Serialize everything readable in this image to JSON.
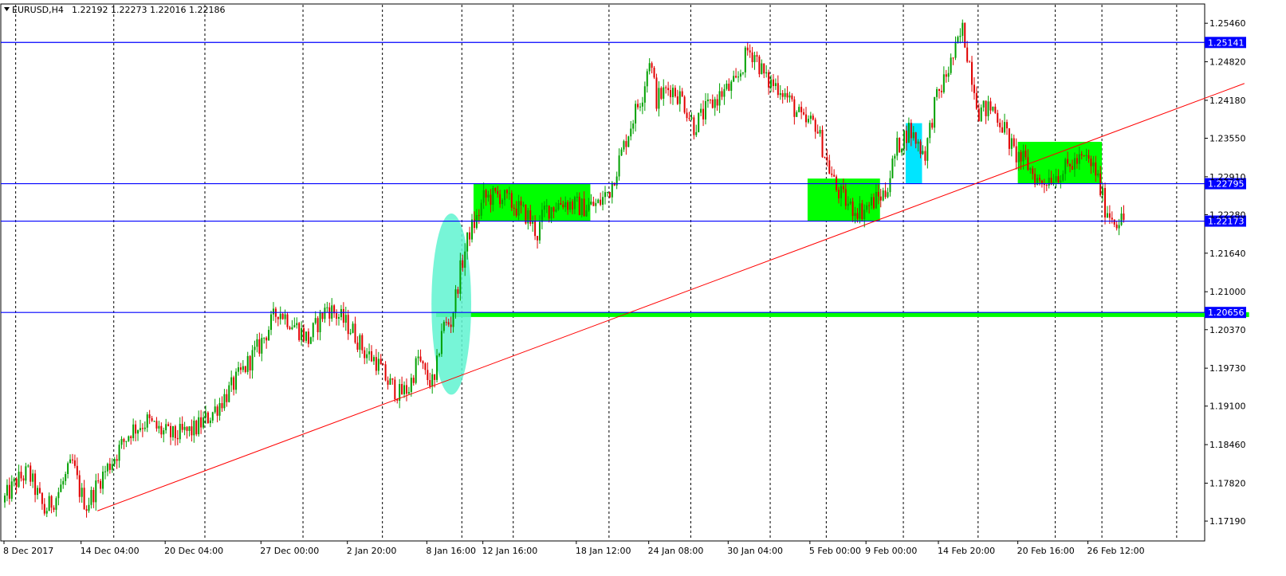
{
  "header": {
    "symbol": "EURUSD,H4",
    "quote": "1.22192 1.22273 1.22016 1.22186",
    "menu_icon": "triangle-down-icon"
  },
  "colors": {
    "bull": "#00a000",
    "bear": "#e00000",
    "level_line": "#0000ff",
    "trend_line": "#ff0000",
    "zone": "#00ff00",
    "highlight": "#5ff3d0",
    "marker": "#00e5ff"
  },
  "chart_data": {
    "type": "candlestick",
    "symbol": "EURUSD",
    "timeframe": "H4",
    "ylim": [
      1.1686,
      1.2578
    ],
    "y_ticks": [
      1.2546,
      1.2482,
      1.2418,
      1.2355,
      1.2291,
      1.2228,
      1.2164,
      1.21,
      1.2037,
      1.1973,
      1.191,
      1.1846,
      1.1782,
      1.1719
    ],
    "y_tick_labels": [
      "1.25460",
      "1.24820",
      "1.24180",
      "1.23550",
      "1.22910",
      "1.22280",
      "1.21640",
      "1.21000",
      "1.20370",
      "1.19730",
      "1.19100",
      "1.18460",
      "1.17820",
      "1.17190"
    ],
    "x_labels": [
      {
        "label": "8 Dec 2017",
        "bar": 0
      },
      {
        "label": "14 Dec 04:00",
        "bar": 33
      },
      {
        "label": "20 Dec 04:00",
        "bar": 69
      },
      {
        "label": "27 Dec 00:00",
        "bar": 110
      },
      {
        "label": "2 Jan 20:00",
        "bar": 147
      },
      {
        "label": "8 Jan 16:00",
        "bar": 181
      },
      {
        "label": "12 Jan 16:00",
        "bar": 205
      },
      {
        "label": "18 Jan 12:00",
        "bar": 245
      },
      {
        "label": "24 Jan 08:00",
        "bar": 276
      },
      {
        "label": "30 Jan 04:00",
        "bar": 310
      },
      {
        "label": "5 Feb 00:00",
        "bar": 345
      },
      {
        "label": "9 Feb 00:00",
        "bar": 369
      },
      {
        "label": "14 Feb 20:00",
        "bar": 400
      },
      {
        "label": "20 Feb 16:00",
        "bar": 434
      },
      {
        "label": "26 Feb 12:00",
        "bar": 464
      }
    ],
    "period_separators_bar": [
      5,
      47,
      86,
      128,
      162,
      196,
      218,
      259,
      294,
      328,
      352,
      385,
      417,
      450,
      470,
      502
    ],
    "anchors": [
      [
        0,
        1.175
      ],
      [
        6,
        1.1785
      ],
      [
        11,
        1.18
      ],
      [
        18,
        1.1735
      ],
      [
        23,
        1.176
      ],
      [
        30,
        1.1815
      ],
      [
        33,
        1.177
      ],
      [
        36,
        1.1745
      ],
      [
        42,
        1.179
      ],
      [
        47,
        1.182
      ],
      [
        55,
        1.187
      ],
      [
        62,
        1.1885
      ],
      [
        67,
        1.187
      ],
      [
        73,
        1.186
      ],
      [
        82,
        1.187
      ],
      [
        89,
        1.1895
      ],
      [
        97,
        1.1935
      ],
      [
        104,
        1.1975
      ],
      [
        110,
        1.201
      ],
      [
        114,
        1.204
      ],
      [
        118,
        1.207
      ],
      [
        125,
        1.2045
      ],
      [
        131,
        1.202
      ],
      [
        136,
        1.2055
      ],
      [
        139,
        1.2075
      ],
      [
        145,
        1.2055
      ],
      [
        150,
        1.2035
      ],
      [
        155,
        1.2
      ],
      [
        160,
        1.1985
      ],
      [
        165,
        1.195
      ],
      [
        170,
        1.193
      ],
      [
        174,
        1.194
      ],
      [
        178,
        1.199
      ],
      [
        181,
        1.196
      ],
      [
        185,
        1.1945
      ],
      [
        188,
        1.204
      ],
      [
        192,
        1.205
      ],
      [
        196,
        1.2135
      ],
      [
        200,
        1.22
      ],
      [
        203,
        1.222
      ],
      [
        206,
        1.2255
      ],
      [
        213,
        1.226
      ],
      [
        220,
        1.224
      ],
      [
        225,
        1.2225
      ],
      [
        229,
        1.2195
      ],
      [
        232,
        1.2235
      ],
      [
        240,
        1.225
      ],
      [
        248,
        1.224
      ],
      [
        255,
        1.2245
      ],
      [
        260,
        1.227
      ],
      [
        265,
        1.233
      ],
      [
        270,
        1.239
      ],
      [
        274,
        1.243
      ],
      [
        277,
        1.249
      ],
      [
        280,
        1.242
      ],
      [
        286,
        1.244
      ],
      [
        291,
        1.242
      ],
      [
        296,
        1.2375
      ],
      [
        302,
        1.2405
      ],
      [
        308,
        1.243
      ],
      [
        314,
        1.2445
      ],
      [
        319,
        1.25
      ],
      [
        322,
        1.2495
      ],
      [
        327,
        1.245
      ],
      [
        333,
        1.244
      ],
      [
        338,
        1.241
      ],
      [
        343,
        1.238
      ],
      [
        348,
        1.238
      ],
      [
        353,
        1.2315
      ],
      [
        357,
        1.227
      ],
      [
        363,
        1.224
      ],
      [
        368,
        1.2235
      ],
      [
        373,
        1.225
      ],
      [
        378,
        1.2265
      ],
      [
        383,
        1.234
      ],
      [
        388,
        1.237
      ],
      [
        393,
        1.234
      ],
      [
        395,
        1.233
      ],
      [
        399,
        1.241
      ],
      [
        404,
        1.246
      ],
      [
        408,
        1.25
      ],
      [
        411,
        1.2535
      ],
      [
        414,
        1.248
      ],
      [
        418,
        1.24
      ],
      [
        424,
        1.2405
      ],
      [
        429,
        1.237
      ],
      [
        433,
        1.233
      ],
      [
        438,
        1.2315
      ],
      [
        444,
        1.228
      ],
      [
        448,
        1.229
      ],
      [
        454,
        1.23
      ],
      [
        459,
        1.2315
      ],
      [
        464,
        1.232
      ],
      [
        468,
        1.23
      ],
      [
        472,
        1.224
      ],
      [
        476,
        1.222
      ],
      [
        479,
        1.2219
      ]
    ],
    "series": [],
    "levels": [
      {
        "label": "1.25141",
        "value": 1.25141
      },
      {
        "label": "1.22795",
        "value": 1.22795
      },
      {
        "label": "1.22173",
        "value": 1.22173
      },
      {
        "label": "1.20656",
        "value": 1.20656
      }
    ],
    "trend_line": {
      "from": [
        40,
        1.1736
      ],
      "to": [
        531,
        1.2446
      ]
    },
    "zones": [
      {
        "from_bar": 201,
        "to_bar": 251,
        "low": 1.2217,
        "high": 1.228
      },
      {
        "from_bar": 344,
        "to_bar": 375,
        "low": 1.2217,
        "high": 1.2288
      },
      {
        "from_bar": 434,
        "to_bar": 470,
        "low": 1.228,
        "high": 1.2349
      },
      {
        "from_bar": 185,
        "to_bar": 533,
        "low": 1.2058,
        "high": 1.2066
      }
    ],
    "highlights": [
      {
        "shape": "ellipse",
        "from_bar": 183,
        "to_bar": 200,
        "low": 1.1929,
        "high": 1.223
      },
      {
        "shape": "rect",
        "from_bar": 386,
        "to_bar": 393,
        "low": 1.228,
        "high": 1.238
      }
    ]
  }
}
